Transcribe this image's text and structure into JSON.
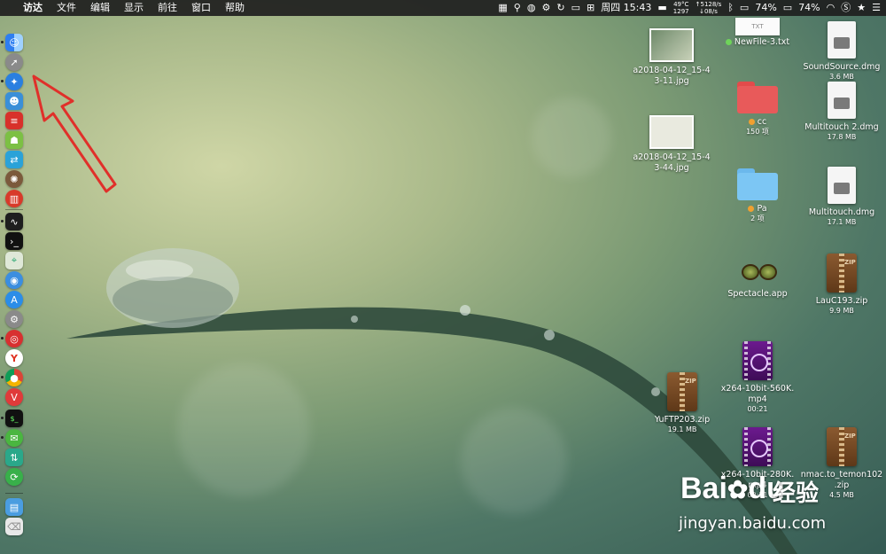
{
  "menubar": {
    "apple_glyph": "",
    "app_name": "访达",
    "items": [
      "文件",
      "编辑",
      "显示",
      "前往",
      "窗口",
      "帮助"
    ],
    "tray": {
      "clock": "周四 15:43",
      "temp": "49°C",
      "rpm": "1297",
      "net_up": "↑5128/s",
      "net_down": "↓08/s",
      "battery1": "74%",
      "battery2": "74%"
    }
  },
  "desktop": {
    "img1": {
      "name": "a2018-04-12_15-4\n3-11.jpg"
    },
    "img2": {
      "name": "a2018-04-12_15-4\n3-44.jpg"
    },
    "txt": {
      "badge": "TXT",
      "name": "NewFile-3.txt",
      "tag_color": "#6fd35a"
    },
    "cc": {
      "name": "cc",
      "sub": "150 项",
      "tag_color": "#f0a030"
    },
    "pa": {
      "name": "Pa",
      "sub": "2 项",
      "tag_color": "#f0a030"
    },
    "soundsource": {
      "name": "SoundSource.dmg",
      "sub": "3.6 MB"
    },
    "mt2": {
      "name": "Multitouch 2.dmg",
      "sub": "17.8 MB"
    },
    "mt": {
      "name": "Multitouch.dmg",
      "sub": "17.1 MB"
    },
    "spectacle": {
      "name": "Spectacle.app"
    },
    "lauc": {
      "name": "LauC193.zip",
      "sub": "9.9 MB"
    },
    "x560": {
      "name": "x264-10bit-560K.\nmp4",
      "sub": "00:21"
    },
    "yuftp": {
      "name": "YuFTP203.zip",
      "sub": "19.1 MB"
    },
    "x280": {
      "name": "x264-10bit-280K.\nmp4",
      "sub": "00:21"
    },
    "nmac": {
      "name": "nmac.to_temon102\n.zip",
      "sub": "4.5 MB"
    }
  },
  "watermark": {
    "brand": "Bai",
    "du": "du",
    "chinese": "经验",
    "url": "jingyan.baidu.com"
  },
  "colors": {
    "arrow": "#e0302a",
    "menubar": "#1e1e1e"
  }
}
